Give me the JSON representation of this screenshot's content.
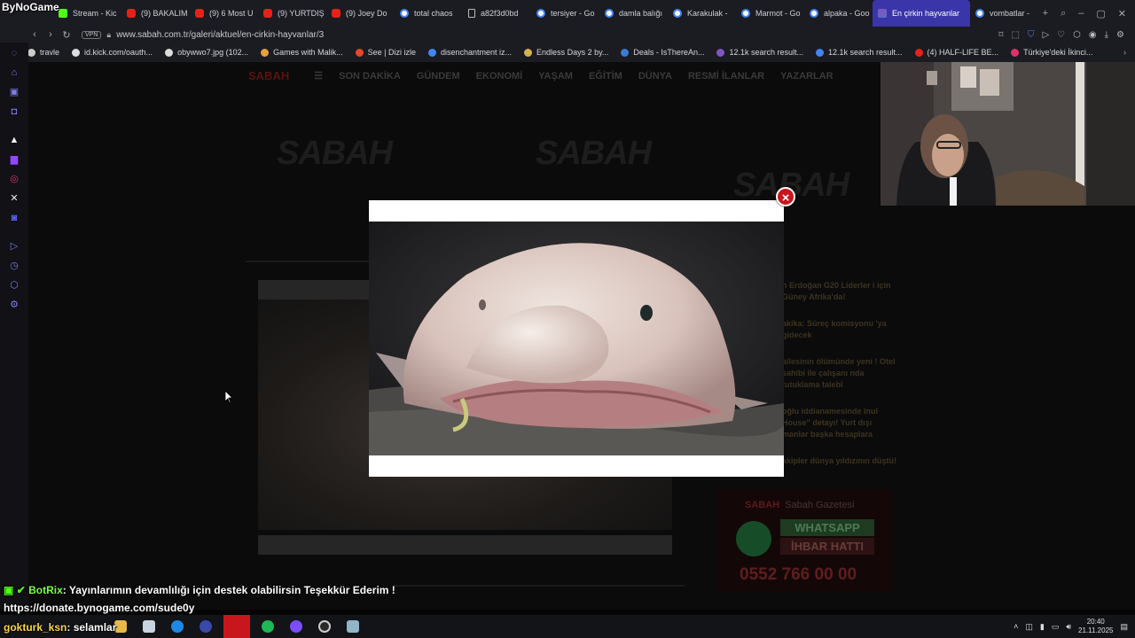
{
  "overlay_brand": "ByNoGame",
  "tabs": [
    {
      "label": "Stream - Kic",
      "icon": "kick"
    },
    {
      "label": "(9) BAKALIM",
      "icon": "yt"
    },
    {
      "label": "(9) 6 Most U",
      "icon": "yt"
    },
    {
      "label": "(9) YURTDIŞ",
      "icon": "yt"
    },
    {
      "label": "(9) Joey Do",
      "icon": "yt"
    },
    {
      "label": "total chaos",
      "icon": "g"
    },
    {
      "label": "a82f3d0bd",
      "icon": "doc"
    },
    {
      "label": "tersiyer - Go",
      "icon": "g"
    },
    {
      "label": "damla balığı",
      "icon": "g"
    },
    {
      "label": "Karakulak -",
      "icon": "g"
    },
    {
      "label": "Marmot - Go",
      "icon": "g"
    },
    {
      "label": "alpaka - Goo",
      "icon": "g"
    },
    {
      "label": "En çirkin hayvanlar",
      "icon": "flag",
      "active": true
    },
    {
      "label": "vombatlar -",
      "icon": "g"
    }
  ],
  "address": {
    "vpn_label": "VPN",
    "url": "www.sabah.com.tr/galeri/aktuel/en-cirkin-hayvanlar/3"
  },
  "bookmarks": [
    {
      "label": "travle",
      "color": "#cccccc"
    },
    {
      "label": "id.kick.com/oauth...",
      "color": "#dddddd"
    },
    {
      "label": "obywwo7.jpg (102...",
      "color": "#dddddd"
    },
    {
      "label": "Games with Malik...",
      "color": "#e9a13b"
    },
    {
      "label": "See | Dizi izle",
      "color": "#e8452c"
    },
    {
      "label": "disenchantment iz...",
      "color": "#4285f4"
    },
    {
      "label": "Endless Days 2 by...",
      "color": "#d4b24a"
    },
    {
      "label": "Deals - IsThereAn...",
      "color": "#3a7bd5"
    },
    {
      "label": "12.1k search result...",
      "color": "#7e57c2"
    },
    {
      "label": "12.1k search result...",
      "color": "#4285f4"
    },
    {
      "label": "(4) HALF-LIFE BE...",
      "color": "#e62117"
    },
    {
      "label": "Türkiye'deki İkinci...",
      "color": "#e1306c"
    }
  ],
  "site_nav": [
    "SON DAKİKA",
    "GÜNDEM",
    "EKONOMİ",
    "YAŞAM",
    "EĞİTİM",
    "DÜNYA",
    "RESMİ İLANLAR",
    "YAZARLAR"
  ],
  "site_logo": "SABAH",
  "news": [
    "n Erdoğan G20 Liderler i için Güney Afrika'da!",
    "akika: Süreç komisyonu 'ya gidecek",
    "ailesinin ölümünde yeni ! Otel sahibi ile çalışanı nda tutuklama talebi",
    "oğlu iddianamesinde inul House\" detayı! Yurt dışı manlar başka hesaplara",
    "akipler dünya yıldızının düştü!"
  ],
  "ad": {
    "brand": "SABAH",
    "title": "Sabah Gazetesi",
    "whatsapp": "WHATSAPP",
    "hotline": "İHBAR HATTI",
    "phone": "0552 766 00 00"
  },
  "modal": {
    "close_label": "×"
  },
  "chat": {
    "bot_name": "BotRix",
    "bot_message": ": Yayınlarımın devamlılığı için destek olabilirsin Teşekkür Ederim !",
    "donate_url": "https://donate.bynogame.com/sude0y",
    "user_name": "gokturk_ksn",
    "user_message": ": selamlar"
  },
  "taskbar": {
    "time": "20:40",
    "date": "21.11.2025"
  },
  "colors": {
    "active_tab": "#3a35a8",
    "close_button": "#c8161d",
    "chat_name": "#7cff3c"
  }
}
